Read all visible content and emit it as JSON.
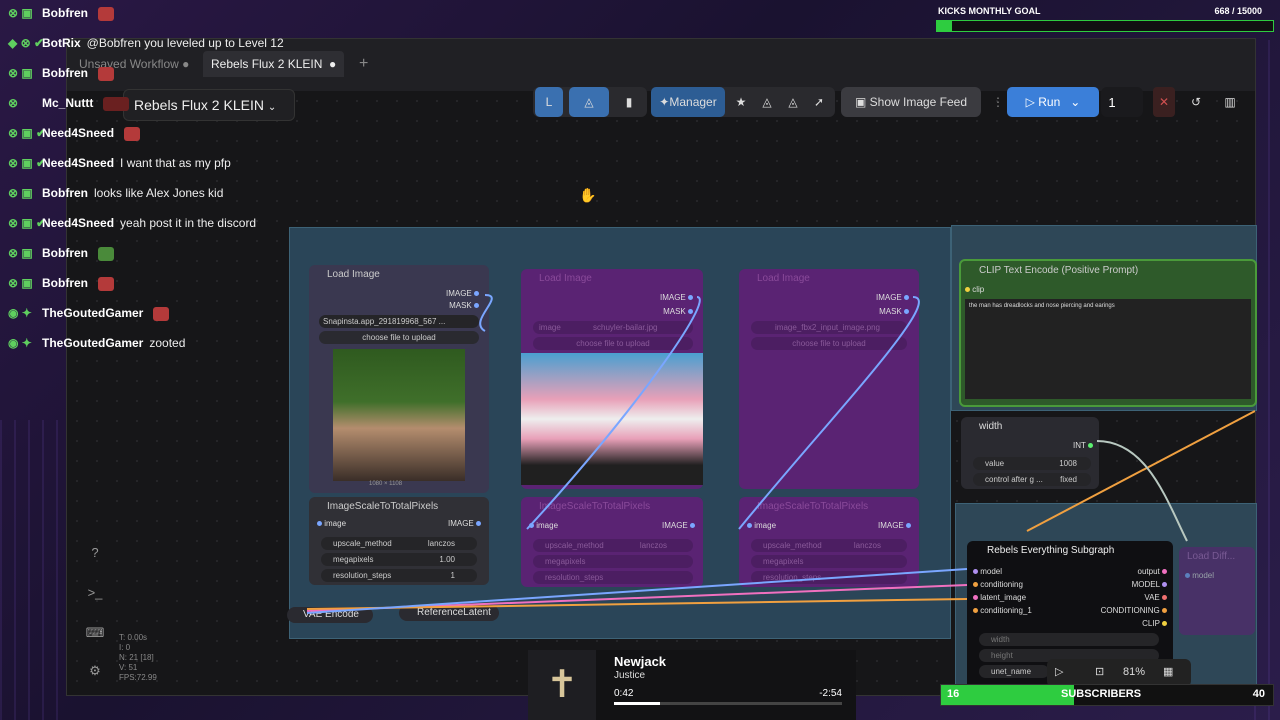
{
  "tabs": [
    {
      "label": "Unsaved Workflow"
    },
    {
      "label": "Rebels Flux 2 KLEIN"
    }
  ],
  "new_tab": "+",
  "workflow_name": "Rebels Flux 2 KLEIN",
  "toolbar": {
    "manager": "Manager",
    "show_image_feed": "Show Image Feed",
    "run": "Run",
    "run_count": "1"
  },
  "chat": [
    {
      "user": "Bobfren",
      "msg": ""
    },
    {
      "user": "BotRix",
      "msg": "@Bobfren you leveled up to Level 12"
    },
    {
      "user": "Bobfren",
      "msg": ""
    },
    {
      "user": "Mc_Nuttt",
      "msg": ""
    },
    {
      "user": "Need4Sneed",
      "msg": ""
    },
    {
      "user": "Need4Sneed",
      "msg": "I want that as my pfp"
    },
    {
      "user": "Bobfren",
      "msg": "looks like Alex Jones kid"
    },
    {
      "user": "Need4Sneed",
      "msg": "yeah post it in the discord"
    },
    {
      "user": "Bobfren",
      "msg": ""
    },
    {
      "user": "Bobfren",
      "msg": ""
    },
    {
      "user": "TheGoutedGamer",
      "msg": ""
    },
    {
      "user": "TheGoutedGamer",
      "msg": "zooted"
    }
  ],
  "goal": {
    "title": "KICKS MONTHLY GOAL",
    "value": "668 / 15000",
    "progress": 0.045
  },
  "nodes": {
    "load_image": {
      "title": "Load Image",
      "out_image": "IMAGE",
      "out_mask": "MASK",
      "file": "Snapinsta.app_291819968_567 ...",
      "upload": "choose file to upload",
      "dims": "1080 × 1108"
    },
    "load_image2": {
      "title": "Load Image",
      "out_image": "IMAGE",
      "out_mask": "MASK",
      "label": "image",
      "file": "schuyler-bailar.jpg",
      "upload": "choose file to upload"
    },
    "load_image3": {
      "title": "Load Image",
      "out_image": "IMAGE",
      "out_mask": "MASK",
      "file": "image_fbx2_input_image.png",
      "upload": "choose file to upload"
    },
    "scale": {
      "title": "ImageScaleToTotalPixels",
      "in": "image",
      "out": "IMAGE",
      "w1_label": "upscale_method",
      "w1_val": "lanczos",
      "w2_label": "megapixels",
      "w2_val": "1.00",
      "w3_label": "resolution_steps",
      "w3_val": "1"
    },
    "scale2": {
      "title": "ImageScaleToTotalPixels",
      "in": "image",
      "out": "IMAGE",
      "w1_label": "upscale_method",
      "w1_val": "lanczos",
      "w2_label": "megapixels",
      "w3_label": "resolution_steps"
    },
    "scale3": {
      "title": "ImageScaleToTotalPixels",
      "in": "image",
      "out": "IMAGE",
      "w1_label": "upscale_method",
      "w1_val": "lanczos",
      "w2_label": "megapixels",
      "w3_label": "resolution_steps"
    },
    "clip": {
      "title": "CLIP Text Encode (Positive Prompt)",
      "in": "clip",
      "text": "the man has dreadlocks and nose piercing and earings"
    },
    "width": {
      "title": "width",
      "out": "INT",
      "w1_label": "value",
      "w1_val": "1008",
      "w2_label": "control after g ...",
      "w2_val": "fixed"
    },
    "vae": {
      "title": "VAE Encode"
    },
    "ref": {
      "title": "ReferenceLatent"
    },
    "subgraph": {
      "title": "Rebels Everything Subgraph",
      "in1": "model",
      "in2": "conditioning",
      "in3": "latent_image",
      "in4": "conditioning_1",
      "out1": "output",
      "out2": "MODEL",
      "out3": "VAE",
      "out4": "CONDITIONING",
      "out5": "CLIP",
      "w1": "width",
      "w2": "height",
      "w3": "unet_name"
    },
    "partial": {
      "title": "Load Diff...",
      "in": "model"
    }
  },
  "stats": {
    "t": "T: 0.00s",
    "i": "I: 0",
    "n": "N: 21 [18]",
    "v": "V: 51",
    "fps": "FPS:72.99"
  },
  "zoom": "81%",
  "music": {
    "title": "Newjack",
    "artist": "Justice",
    "elapsed": "0:42",
    "remaining": "-2:54",
    "progress": 0.2
  },
  "subs": {
    "current": "16",
    "label": "SUBSCRIBERS",
    "goal": "40",
    "progress": 0.4
  }
}
